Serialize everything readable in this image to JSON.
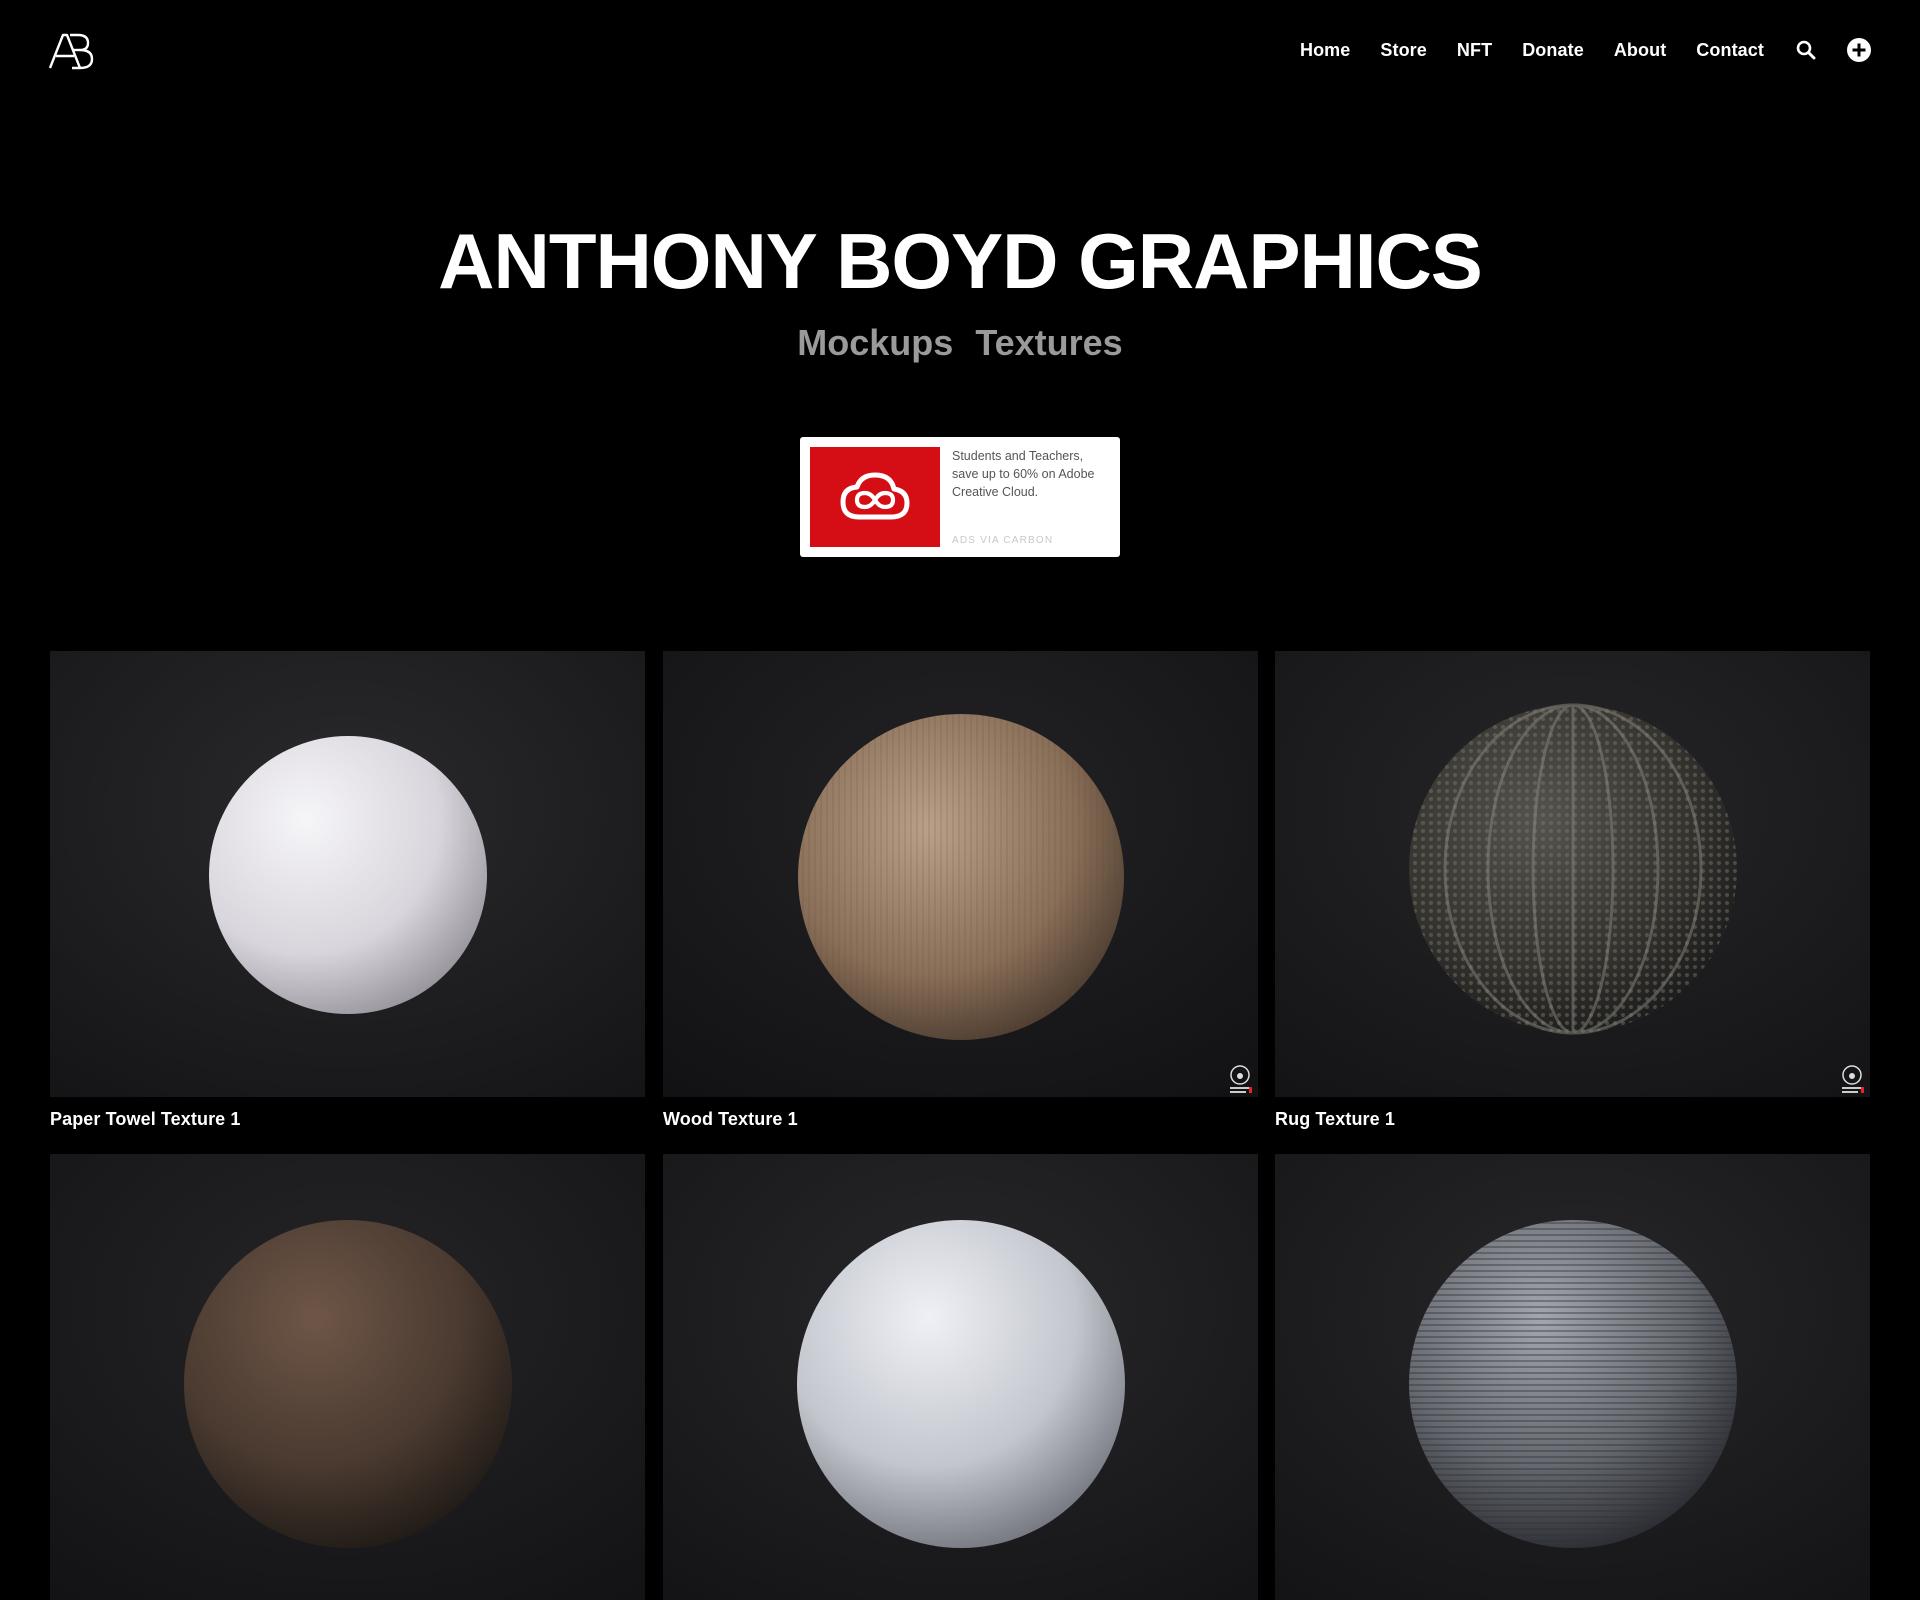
{
  "header": {
    "logo_text": "AB",
    "nav": [
      {
        "label": "Home"
      },
      {
        "label": "Store"
      },
      {
        "label": "NFT"
      },
      {
        "label": "Donate"
      },
      {
        "label": "About"
      },
      {
        "label": "Contact"
      }
    ],
    "icons": [
      "search-icon",
      "plus-circle-icon"
    ]
  },
  "hero": {
    "title": "ANTHONY BOYD GRAPHICS",
    "links": [
      {
        "label": "Mockups"
      },
      {
        "label": "Textures"
      }
    ]
  },
  "ad": {
    "text": "Students and Teachers, save up to 60% on Adobe Creative Cloud.",
    "via": "ADS VIA CARBON",
    "brand_color": "#d40e14",
    "icon": "creative-cloud-icon"
  },
  "textures": [
    {
      "title": "Paper Towel Texture 1",
      "colors": [
        "#f4f2f6",
        "#b9b6bf",
        "#6e6b73"
      ]
    },
    {
      "title": "Wood Texture 1",
      "colors": [
        "#b49a80",
        "#7d6450",
        "#3a2d23"
      ]
    },
    {
      "title": "Rug Texture 1",
      "colors": [
        "#6a6862",
        "#3a3935",
        "#17171a"
      ]
    },
    {
      "title": "",
      "colors": [
        "#6b5446",
        "#43342b",
        "#1c1714"
      ]
    },
    {
      "title": "",
      "colors": [
        "#e8eaf0",
        "#b8bac2",
        "#6d6f78"
      ]
    },
    {
      "title": "",
      "colors": [
        "#9a9ca4",
        "#5c5e66",
        "#262830"
      ]
    }
  ],
  "colors": {
    "background": "#000000",
    "text": "#ffffff",
    "muted": "#9a9a9a"
  }
}
